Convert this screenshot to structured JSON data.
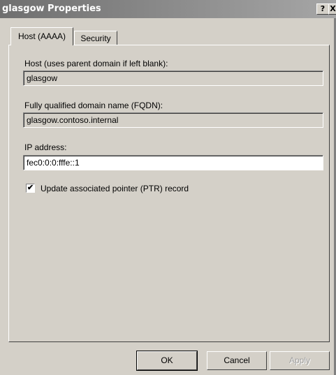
{
  "window": {
    "title": "glasgow Properties",
    "help_icon": "?",
    "close_icon": "X"
  },
  "tabs": [
    {
      "label": "Host (AAAA)",
      "selected": true
    },
    {
      "label": "Security",
      "selected": false
    }
  ],
  "form": {
    "host_label": "Host (uses parent domain if left blank):",
    "host_value": "glasgow",
    "fqdn_label": "Fully qualified domain name (FQDN):",
    "fqdn_value": "glasgow.contoso.internal",
    "ip_label": "IP address:",
    "ip_value": "fec0:0:0:fffe::1",
    "ptr_checked": true,
    "ptr_check_mark": "✔",
    "ptr_label": "Update associated pointer (PTR) record"
  },
  "buttons": {
    "ok": "OK",
    "cancel": "Cancel",
    "apply": "Apply",
    "apply_enabled": false
  }
}
